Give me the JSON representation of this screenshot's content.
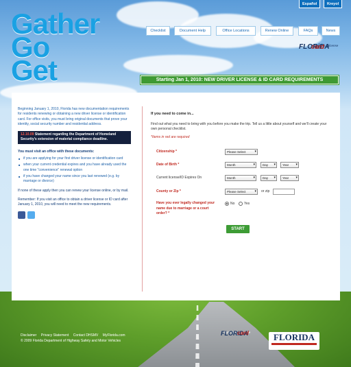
{
  "lang": {
    "espanol": "Español",
    "kreyol": "Kreyol"
  },
  "logo": {
    "line1": "Gather",
    "line2": "Go",
    "line3": "Get"
  },
  "nav": [
    {
      "label": "Checklist"
    },
    {
      "label": "Document Help"
    },
    {
      "label": "Office Locations"
    },
    {
      "label": "Renew Online"
    },
    {
      "label": "FAQs"
    },
    {
      "label": "News"
    }
  ],
  "brand": {
    "flo": "FLORiDA",
    "card": "card",
    "tagline": "more than a license"
  },
  "banner": "Starting Jan 1, 2010: NEW DRIVER LICENSE & ID CARD REQUIREMENTS",
  "left": {
    "intro": "Beginning January 1, 2010, Florida has new documentation requirements for residents renewing or obtaining a new driver license or identification card. For office visits, you must bring original documents that prove your identity, social security number and residential address.",
    "alert_date": "12.10.09",
    "alert_text": "Statement regarding the Department of Homeland Security's extension of material compliance deadline.",
    "visit_heading": "You must visit an office with these documents:",
    "bullets": [
      "if you are applying for your first driver license or identification card",
      "when your current credential expires and you have already used the one time \"convenience\" renewal option",
      "if you have changed your name since you last renewed (e.g. by marriage or divorce)"
    ],
    "none_apply": "If none of these apply then you can renew your license online, or by mail.",
    "remember": "Remember: If you visit an office to obtain a driver license or ID card after January 1, 2010, you will need to meet the new requirements."
  },
  "right": {
    "need": "If you need to come in...",
    "find_out": "Find out what you need to bring with you before you make the trip. Tell us a little about yourself and we'll create your own personal checklist.",
    "required": "*Items in red are required",
    "citizenship": "Citizenship *",
    "citizenship_val": "Please Select",
    "dob": "Date of Birth *",
    "month": "Month",
    "day": "Day",
    "year": "Year",
    "expire": "Current license/ID Expires On",
    "county": "County or Zip *",
    "county_val": "Please Select",
    "or_zip": "or zip",
    "name_change": "Have you ever legally changed your name due to marriage or a court order? *",
    "no": "No",
    "yes": "Yes",
    "start": "START"
  },
  "footer": {
    "disclaimer": "Disclaimer",
    "privacy": "Privacy Statement",
    "contact": "Contact DHSMV",
    "myflorida": "MyFlorida.com",
    "copyright": "© 2009 Florida Department of Highway Safety and Motor Vehicles"
  },
  "footer_brand": {
    "flo": "FLORiDA",
    "card": "card",
    "tagline": "more than a license",
    "seal": "FLORIDA"
  }
}
